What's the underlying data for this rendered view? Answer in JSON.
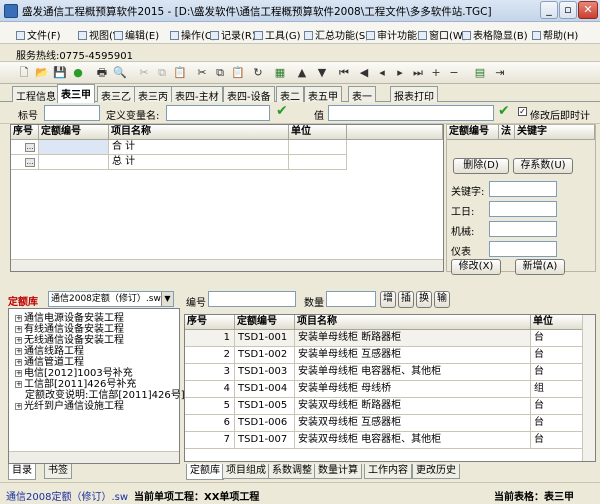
{
  "window": {
    "title": "盛发通信工程概预算软件2015 - [D:\\盛发软件\\通信工程概预算软件2008\\工程文件\\多多软件站.TGC]",
    "buttons": [
      "_",
      "▫",
      "✕"
    ]
  },
  "menu": [
    "文件(F)",
    "视图(V)",
    "编辑(E)",
    "操作(C)",
    "记录(R)",
    "工具(G)",
    "汇总功能(S)",
    "审计功能",
    "窗口(W)",
    "表格隐显(B)",
    "帮助(H)"
  ],
  "hotline": "服务热线:0775-4595901",
  "tabs_top": [
    "工程信息",
    "表三甲",
    "表三乙",
    "表三丙",
    "表四-主材",
    "表四-设备",
    "表二",
    "表五甲",
    "表一",
    "报表打印"
  ],
  "form": {
    "code_label": "标号",
    "var_label": "定义变量名:",
    "value_label": "值",
    "modify_label": "修改后即时计"
  },
  "grid_top": {
    "headers": [
      "序号",
      "定额编号",
      "项目名称",
      "单位"
    ],
    "rows": [
      {
        "name": "合  计"
      },
      {
        "name": "总  计"
      }
    ]
  },
  "right_panel": {
    "header": [
      "定额编号",
      "法",
      "关键字"
    ],
    "delete_label": "删除(D)",
    "save_label": "存系数(U)",
    "fields": [
      "关键字:",
      "工日:",
      "机械:",
      "仪表"
    ],
    "modify_label": "修改(X)",
    "add_label": "新增(A)"
  },
  "library": {
    "label": "定额库",
    "selected": "通信2008定额（修订）.sw",
    "tree": [
      "通信电源设备安装工程",
      "有线通信设备安装工程",
      "无线通信设备安装工程",
      "通信线路工程",
      "通信管道工程",
      "电信[2012]1003号补充",
      "工信部[2011]426号补充",
      "定额改变说明:工信部[2011]426号]",
      "光纤到户通信设施工程"
    ],
    "bottom_tabs": [
      "目录",
      "书签"
    ]
  },
  "search": {
    "code_label": "编号",
    "qty_label": "数量",
    "buttons": [
      "增",
      "插",
      "换",
      "输"
    ]
  },
  "grid_bot": {
    "headers": [
      "序号",
      "定额编号",
      "项目名称",
      "单位"
    ],
    "rows": [
      {
        "no": "1",
        "code": "TSD1-001",
        "name": "安装单母线柜 断路器柜",
        "unit": "台"
      },
      {
        "no": "2",
        "code": "TSD1-002",
        "name": "安装单母线柜 互感器柜",
        "unit": "台"
      },
      {
        "no": "3",
        "code": "TSD1-003",
        "name": "安装单母线柜 电容器柜、其他柜",
        "unit": "台"
      },
      {
        "no": "4",
        "code": "TSD1-004",
        "name": "安装单母线柜 母线桥",
        "unit": "组"
      },
      {
        "no": "5",
        "code": "TSD1-005",
        "name": "安装双母线柜 断路器柜",
        "unit": "台"
      },
      {
        "no": "6",
        "code": "TSD1-006",
        "name": "安装双母线柜 互感器柜",
        "unit": "台"
      },
      {
        "no": "7",
        "code": "TSD1-007",
        "name": "安装双母线柜 电容器柜、其他柜",
        "unit": "台"
      }
    ]
  },
  "bottom_tabs": [
    "定额库",
    "项目组成",
    "系数调整",
    "数量计算",
    "工作内容",
    "更改历史"
  ],
  "status": {
    "left": "通信2008定额（修订）.sw",
    "mid": "当前单项工程：XX单项工程",
    "right": "当前表格：表三甲"
  }
}
